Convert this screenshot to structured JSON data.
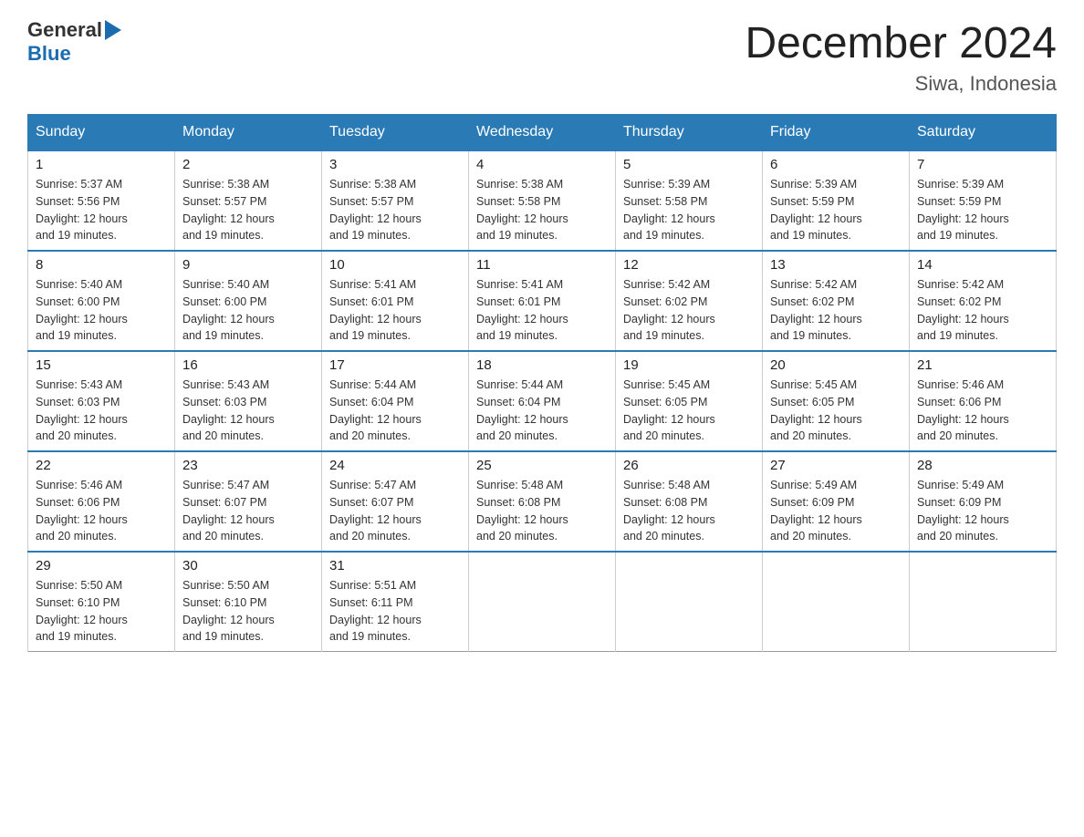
{
  "logo": {
    "text_general": "General",
    "text_blue": "Blue",
    "triangle": "▶"
  },
  "header": {
    "month": "December 2024",
    "location": "Siwa, Indonesia"
  },
  "weekdays": [
    "Sunday",
    "Monday",
    "Tuesday",
    "Wednesday",
    "Thursday",
    "Friday",
    "Saturday"
  ],
  "weeks": [
    [
      {
        "day": "1",
        "sunrise": "5:37 AM",
        "sunset": "5:56 PM",
        "daylight": "12 hours and 19 minutes."
      },
      {
        "day": "2",
        "sunrise": "5:38 AM",
        "sunset": "5:57 PM",
        "daylight": "12 hours and 19 minutes."
      },
      {
        "day": "3",
        "sunrise": "5:38 AM",
        "sunset": "5:57 PM",
        "daylight": "12 hours and 19 minutes."
      },
      {
        "day": "4",
        "sunrise": "5:38 AM",
        "sunset": "5:58 PM",
        "daylight": "12 hours and 19 minutes."
      },
      {
        "day": "5",
        "sunrise": "5:39 AM",
        "sunset": "5:58 PM",
        "daylight": "12 hours and 19 minutes."
      },
      {
        "day": "6",
        "sunrise": "5:39 AM",
        "sunset": "5:59 PM",
        "daylight": "12 hours and 19 minutes."
      },
      {
        "day": "7",
        "sunrise": "5:39 AM",
        "sunset": "5:59 PM",
        "daylight": "12 hours and 19 minutes."
      }
    ],
    [
      {
        "day": "8",
        "sunrise": "5:40 AM",
        "sunset": "6:00 PM",
        "daylight": "12 hours and 19 minutes."
      },
      {
        "day": "9",
        "sunrise": "5:40 AM",
        "sunset": "6:00 PM",
        "daylight": "12 hours and 19 minutes."
      },
      {
        "day": "10",
        "sunrise": "5:41 AM",
        "sunset": "6:01 PM",
        "daylight": "12 hours and 19 minutes."
      },
      {
        "day": "11",
        "sunrise": "5:41 AM",
        "sunset": "6:01 PM",
        "daylight": "12 hours and 19 minutes."
      },
      {
        "day": "12",
        "sunrise": "5:42 AM",
        "sunset": "6:02 PM",
        "daylight": "12 hours and 19 minutes."
      },
      {
        "day": "13",
        "sunrise": "5:42 AM",
        "sunset": "6:02 PM",
        "daylight": "12 hours and 19 minutes."
      },
      {
        "day": "14",
        "sunrise": "5:42 AM",
        "sunset": "6:02 PM",
        "daylight": "12 hours and 19 minutes."
      }
    ],
    [
      {
        "day": "15",
        "sunrise": "5:43 AM",
        "sunset": "6:03 PM",
        "daylight": "12 hours and 20 minutes."
      },
      {
        "day": "16",
        "sunrise": "5:43 AM",
        "sunset": "6:03 PM",
        "daylight": "12 hours and 20 minutes."
      },
      {
        "day": "17",
        "sunrise": "5:44 AM",
        "sunset": "6:04 PM",
        "daylight": "12 hours and 20 minutes."
      },
      {
        "day": "18",
        "sunrise": "5:44 AM",
        "sunset": "6:04 PM",
        "daylight": "12 hours and 20 minutes."
      },
      {
        "day": "19",
        "sunrise": "5:45 AM",
        "sunset": "6:05 PM",
        "daylight": "12 hours and 20 minutes."
      },
      {
        "day": "20",
        "sunrise": "5:45 AM",
        "sunset": "6:05 PM",
        "daylight": "12 hours and 20 minutes."
      },
      {
        "day": "21",
        "sunrise": "5:46 AM",
        "sunset": "6:06 PM",
        "daylight": "12 hours and 20 minutes."
      }
    ],
    [
      {
        "day": "22",
        "sunrise": "5:46 AM",
        "sunset": "6:06 PM",
        "daylight": "12 hours and 20 minutes."
      },
      {
        "day": "23",
        "sunrise": "5:47 AM",
        "sunset": "6:07 PM",
        "daylight": "12 hours and 20 minutes."
      },
      {
        "day": "24",
        "sunrise": "5:47 AM",
        "sunset": "6:07 PM",
        "daylight": "12 hours and 20 minutes."
      },
      {
        "day": "25",
        "sunrise": "5:48 AM",
        "sunset": "6:08 PM",
        "daylight": "12 hours and 20 minutes."
      },
      {
        "day": "26",
        "sunrise": "5:48 AM",
        "sunset": "6:08 PM",
        "daylight": "12 hours and 20 minutes."
      },
      {
        "day": "27",
        "sunrise": "5:49 AM",
        "sunset": "6:09 PM",
        "daylight": "12 hours and 20 minutes."
      },
      {
        "day": "28",
        "sunrise": "5:49 AM",
        "sunset": "6:09 PM",
        "daylight": "12 hours and 20 minutes."
      }
    ],
    [
      {
        "day": "29",
        "sunrise": "5:50 AM",
        "sunset": "6:10 PM",
        "daylight": "12 hours and 19 minutes."
      },
      {
        "day": "30",
        "sunrise": "5:50 AM",
        "sunset": "6:10 PM",
        "daylight": "12 hours and 19 minutes."
      },
      {
        "day": "31",
        "sunrise": "5:51 AM",
        "sunset": "6:11 PM",
        "daylight": "12 hours and 19 minutes."
      },
      null,
      null,
      null,
      null
    ]
  ],
  "labels": {
    "sunrise": "Sunrise:",
    "sunset": "Sunset:",
    "daylight": "Daylight:"
  }
}
